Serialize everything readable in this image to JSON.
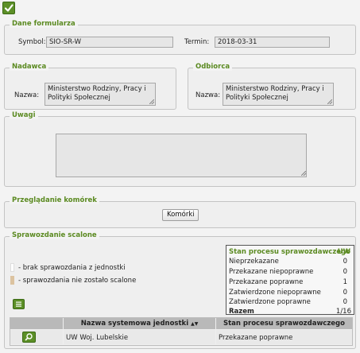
{
  "toolbar": {
    "confirm_icon": "check-icon"
  },
  "form_data": {
    "legend": "Dane formularza",
    "symbol_label": "Symbol:",
    "symbol_value": "SIO-SR-W",
    "term_label": "Termin:",
    "term_value": "2018-03-31"
  },
  "sender": {
    "legend": "Nadawca",
    "name_label": "Nazwa:",
    "name_line1": "Ministerstwo Rodziny, Pracy i",
    "name_line2": "Polityki Społecznej"
  },
  "recipient": {
    "legend": "Odbiorca",
    "name_label": "Nazwa:",
    "name_line1": "Ministerstwo Rodziny, Pracy i",
    "name_line2": "Polityki Społecznej"
  },
  "notes": {
    "legend": "Uwagi",
    "value": ""
  },
  "cells": {
    "legend": "Przeglądanie komórek",
    "button_label": "Komórki"
  },
  "report": {
    "legend": "Sprawozdanie scalone",
    "legend_items": [
      {
        "label": "- brak sprawozdania z jednostki",
        "color": "#ffffff"
      },
      {
        "label": "- sprawozdania nie zostało scalone",
        "color": "#dcc3a0"
      }
    ],
    "export_icon": "list-icon",
    "status_table": {
      "title": "Stan procesu sprawozdawczego",
      "unit": "UW",
      "rows": [
        {
          "label": "Nieprzekazane",
          "value": "0"
        },
        {
          "label": "Przekazane niepoprawne",
          "value": "0"
        },
        {
          "label": "Przekazane poprawne",
          "value": "1"
        },
        {
          "label": "Zatwierdzone niepoprawne",
          "value": "0"
        },
        {
          "label": "Zatwierdzone poprawne",
          "value": "0"
        }
      ],
      "total_label": "Razem",
      "total_value": "1/16"
    },
    "grid": {
      "col_name": "Nazwa systemowa jednostki",
      "col_status": "Stan procesu sprawozdawczego",
      "sort_icon": "sort-arrows-icon",
      "rows": [
        {
          "name": "UW Woj. Lubelskie",
          "status": "Przekazane poprawne"
        }
      ]
    }
  },
  "colors": {
    "accent": "#5b8a21",
    "button_green": "#5c8f27"
  }
}
